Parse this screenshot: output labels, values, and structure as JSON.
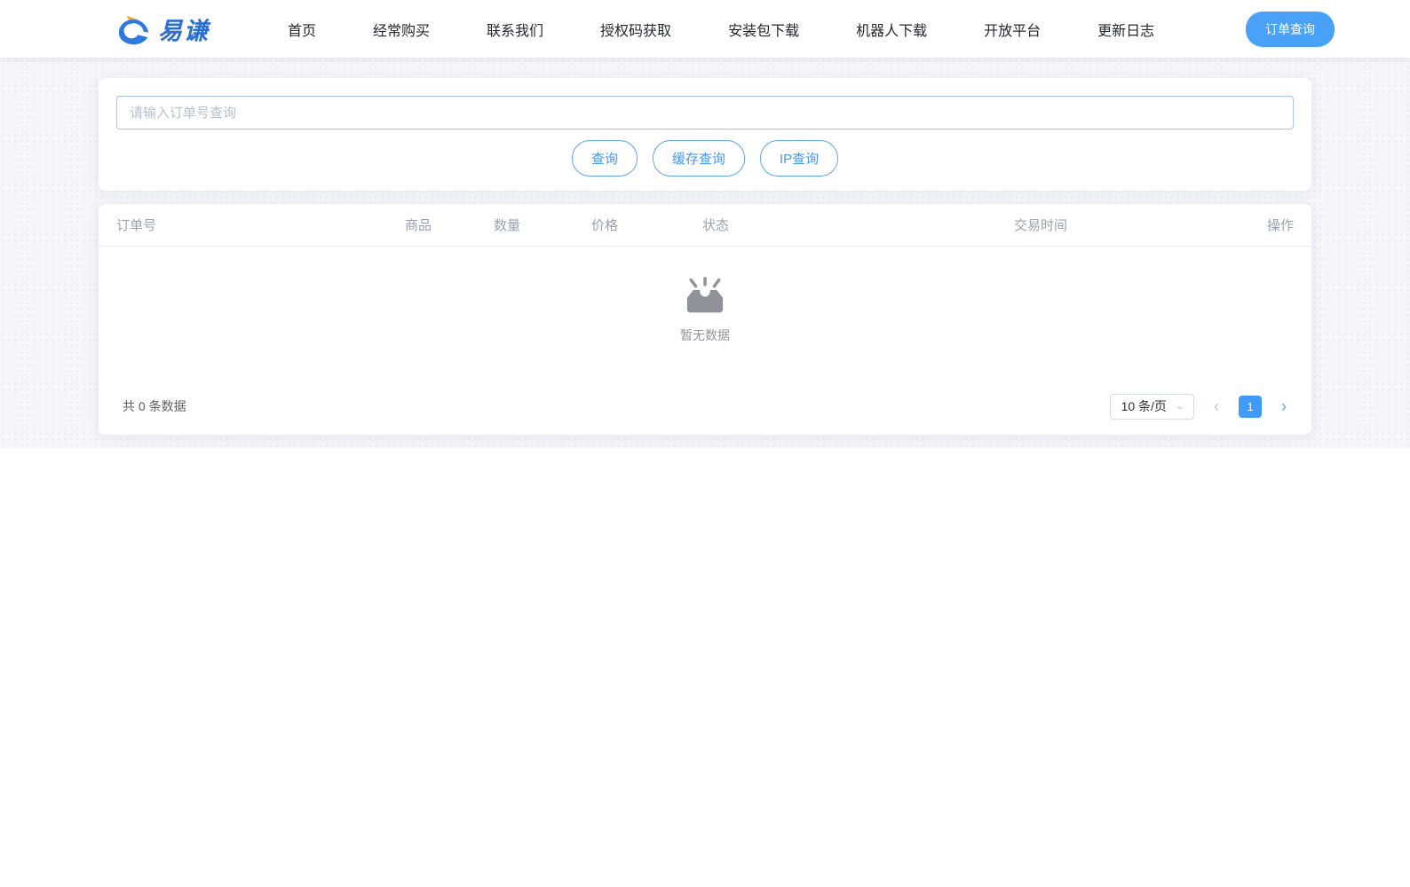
{
  "brand": {
    "name": "易谦"
  },
  "nav": {
    "items": [
      "首页",
      "经常购买",
      "联系我们",
      "授权码获取",
      "安装包下载",
      "机器人下载",
      "开放平台",
      "更新日志"
    ],
    "cta_label": "订单查询"
  },
  "search": {
    "placeholder": "请输入订单号查询",
    "value": "",
    "buttons": [
      "查询",
      "缓存查询",
      "IP查询"
    ]
  },
  "table": {
    "columns": [
      "订单号",
      "商品",
      "数量",
      "价格",
      "状态",
      "交易时间",
      "操作"
    ],
    "rows": [],
    "empty_text": "暂无数据"
  },
  "pagination": {
    "total_text": "共 0 条数据",
    "page_size_label": "10 条/页",
    "current_page": "1",
    "prev_glyph": "‹",
    "next_glyph": "›",
    "chevron_glyph": "⌄"
  },
  "icons": {
    "logo": "swoosh-e-logo",
    "empty": "empty-inbox-icon",
    "select_chevron": "chevron-down-icon"
  },
  "colors": {
    "primary": "#4aa2f8",
    "primary_deep": "#3f9bf7",
    "outline_btn_border": "#5fa2f5",
    "input_border": "#abc4ec",
    "header_text": "#24282e",
    "table_header_text": "#9ba1ac",
    "muted_text": "#8f949b",
    "band_bg": "#f5f6f9",
    "logo_blue": "#2a6fd6",
    "logo_gold": "#f0b13a"
  }
}
